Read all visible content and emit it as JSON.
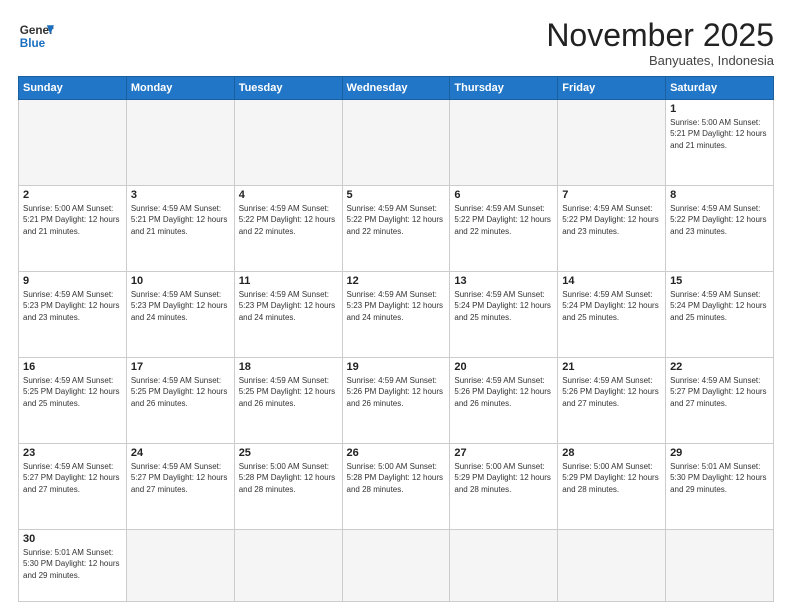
{
  "header": {
    "logo_general": "General",
    "logo_blue": "Blue",
    "month_title": "November 2025",
    "location": "Banyuates, Indonesia"
  },
  "days_of_week": [
    "Sunday",
    "Monday",
    "Tuesday",
    "Wednesday",
    "Thursday",
    "Friday",
    "Saturday"
  ],
  "weeks": [
    [
      {
        "day": "",
        "info": ""
      },
      {
        "day": "",
        "info": ""
      },
      {
        "day": "",
        "info": ""
      },
      {
        "day": "",
        "info": ""
      },
      {
        "day": "",
        "info": ""
      },
      {
        "day": "",
        "info": ""
      },
      {
        "day": "1",
        "info": "Sunrise: 5:00 AM\nSunset: 5:21 PM\nDaylight: 12 hours and 21 minutes."
      }
    ],
    [
      {
        "day": "2",
        "info": "Sunrise: 5:00 AM\nSunset: 5:21 PM\nDaylight: 12 hours and 21 minutes."
      },
      {
        "day": "3",
        "info": "Sunrise: 4:59 AM\nSunset: 5:21 PM\nDaylight: 12 hours and 21 minutes."
      },
      {
        "day": "4",
        "info": "Sunrise: 4:59 AM\nSunset: 5:22 PM\nDaylight: 12 hours and 22 minutes."
      },
      {
        "day": "5",
        "info": "Sunrise: 4:59 AM\nSunset: 5:22 PM\nDaylight: 12 hours and 22 minutes."
      },
      {
        "day": "6",
        "info": "Sunrise: 4:59 AM\nSunset: 5:22 PM\nDaylight: 12 hours and 22 minutes."
      },
      {
        "day": "7",
        "info": "Sunrise: 4:59 AM\nSunset: 5:22 PM\nDaylight: 12 hours and 23 minutes."
      },
      {
        "day": "8",
        "info": "Sunrise: 4:59 AM\nSunset: 5:22 PM\nDaylight: 12 hours and 23 minutes."
      }
    ],
    [
      {
        "day": "9",
        "info": "Sunrise: 4:59 AM\nSunset: 5:23 PM\nDaylight: 12 hours and 23 minutes."
      },
      {
        "day": "10",
        "info": "Sunrise: 4:59 AM\nSunset: 5:23 PM\nDaylight: 12 hours and 24 minutes."
      },
      {
        "day": "11",
        "info": "Sunrise: 4:59 AM\nSunset: 5:23 PM\nDaylight: 12 hours and 24 minutes."
      },
      {
        "day": "12",
        "info": "Sunrise: 4:59 AM\nSunset: 5:23 PM\nDaylight: 12 hours and 24 minutes."
      },
      {
        "day": "13",
        "info": "Sunrise: 4:59 AM\nSunset: 5:24 PM\nDaylight: 12 hours and 25 minutes."
      },
      {
        "day": "14",
        "info": "Sunrise: 4:59 AM\nSunset: 5:24 PM\nDaylight: 12 hours and 25 minutes."
      },
      {
        "day": "15",
        "info": "Sunrise: 4:59 AM\nSunset: 5:24 PM\nDaylight: 12 hours and 25 minutes."
      }
    ],
    [
      {
        "day": "16",
        "info": "Sunrise: 4:59 AM\nSunset: 5:25 PM\nDaylight: 12 hours and 25 minutes."
      },
      {
        "day": "17",
        "info": "Sunrise: 4:59 AM\nSunset: 5:25 PM\nDaylight: 12 hours and 26 minutes."
      },
      {
        "day": "18",
        "info": "Sunrise: 4:59 AM\nSunset: 5:25 PM\nDaylight: 12 hours and 26 minutes."
      },
      {
        "day": "19",
        "info": "Sunrise: 4:59 AM\nSunset: 5:26 PM\nDaylight: 12 hours and 26 minutes."
      },
      {
        "day": "20",
        "info": "Sunrise: 4:59 AM\nSunset: 5:26 PM\nDaylight: 12 hours and 26 minutes."
      },
      {
        "day": "21",
        "info": "Sunrise: 4:59 AM\nSunset: 5:26 PM\nDaylight: 12 hours and 27 minutes."
      },
      {
        "day": "22",
        "info": "Sunrise: 4:59 AM\nSunset: 5:27 PM\nDaylight: 12 hours and 27 minutes."
      }
    ],
    [
      {
        "day": "23",
        "info": "Sunrise: 4:59 AM\nSunset: 5:27 PM\nDaylight: 12 hours and 27 minutes."
      },
      {
        "day": "24",
        "info": "Sunrise: 4:59 AM\nSunset: 5:27 PM\nDaylight: 12 hours and 27 minutes."
      },
      {
        "day": "25",
        "info": "Sunrise: 5:00 AM\nSunset: 5:28 PM\nDaylight: 12 hours and 28 minutes."
      },
      {
        "day": "26",
        "info": "Sunrise: 5:00 AM\nSunset: 5:28 PM\nDaylight: 12 hours and 28 minutes."
      },
      {
        "day": "27",
        "info": "Sunrise: 5:00 AM\nSunset: 5:29 PM\nDaylight: 12 hours and 28 minutes."
      },
      {
        "day": "28",
        "info": "Sunrise: 5:00 AM\nSunset: 5:29 PM\nDaylight: 12 hours and 28 minutes."
      },
      {
        "day": "29",
        "info": "Sunrise: 5:01 AM\nSunset: 5:30 PM\nDaylight: 12 hours and 29 minutes."
      }
    ],
    [
      {
        "day": "30",
        "info": "Sunrise: 5:01 AM\nSunset: 5:30 PM\nDaylight: 12 hours and 29 minutes."
      },
      {
        "day": "",
        "info": ""
      },
      {
        "day": "",
        "info": ""
      },
      {
        "day": "",
        "info": ""
      },
      {
        "day": "",
        "info": ""
      },
      {
        "day": "",
        "info": ""
      },
      {
        "day": "",
        "info": ""
      }
    ]
  ]
}
